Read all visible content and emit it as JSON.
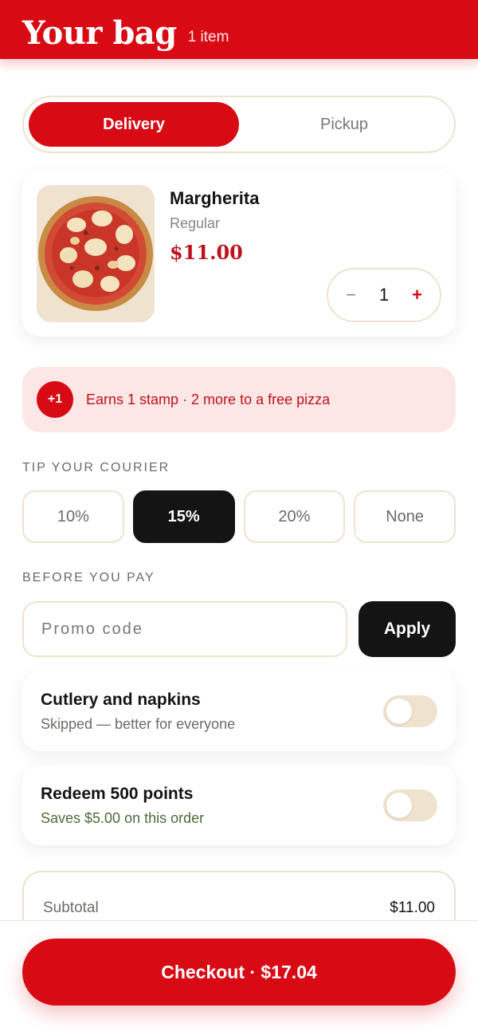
{
  "header": {
    "title": "Your bag",
    "count": "1 item"
  },
  "mode": {
    "options": [
      "Delivery",
      "Pickup"
    ],
    "selected": "Delivery"
  },
  "cart": {
    "items": [
      {
        "name": "Margherita",
        "variant": "Regular",
        "price": "$11.00",
        "quantity": "1",
        "image": "pizza-margherita"
      }
    ],
    "stepper": {
      "minus": "−",
      "plus": "+"
    }
  },
  "stamp": {
    "badge": "+1",
    "text": "Earns 1 stamp · 2 more to a free pizza"
  },
  "tip": {
    "label": "TIP YOUR COURIER",
    "options": [
      "10%",
      "15%",
      "20%",
      "None"
    ],
    "selected": "15%"
  },
  "before_pay": {
    "label": "BEFORE YOU PAY",
    "promo_placeholder": "Promo code",
    "promo_value": "",
    "apply_label": "Apply"
  },
  "options": [
    {
      "title": "Cutlery and napkins",
      "subtitle": "Skipped — better for everyone",
      "enabled": false
    },
    {
      "title": "Redeem 500 points",
      "subtitle": "Saves $5.00 on this order",
      "enabled": false
    }
  ],
  "summary": {
    "subtotal_label": "Subtotal",
    "subtotal_value": "$11.00"
  },
  "checkout": {
    "label": "Checkout · $17.04"
  },
  "colors": {
    "brand": "#d80a14",
    "cream": "#efe3cf",
    "dark": "#141414",
    "banner": "#fde6e6"
  }
}
